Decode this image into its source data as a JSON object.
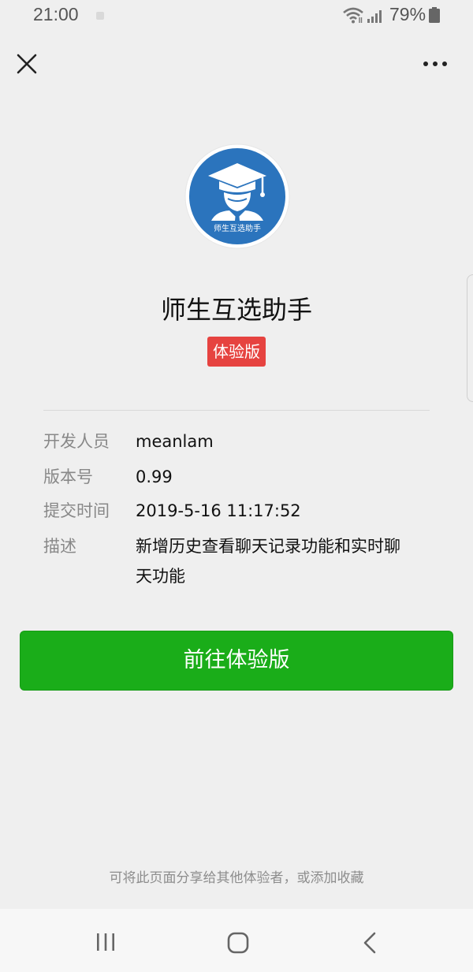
{
  "status_bar": {
    "time": "21:00",
    "battery": "79%"
  },
  "nav": {
    "close_icon": "close-icon",
    "more_icon": "more-icon"
  },
  "app": {
    "name": "师生互选助手",
    "badge": "体验版",
    "logo_text": "师生互选助手",
    "logo_colors": {
      "ring": "#ffffff",
      "circle": "#2b74bd",
      "figure": "#ffffff"
    }
  },
  "info": {
    "developer_label": "开发人员",
    "developer_value": "meanlam",
    "version_label": "版本号",
    "version_value": "0.99",
    "submit_time_label": "提交时间",
    "submit_time_value": "2019-5-16 11:17:52",
    "description_label": "描述",
    "description_value_line1": "新增历史查看聊天记录功能和实时聊",
    "description_value_line2": "天功能"
  },
  "actions": {
    "open_trial_label": "前往体验版"
  },
  "footer": {
    "share_note": "可将此页面分享给其他体验者，或添加收藏"
  },
  "colors": {
    "background": "#efefef",
    "primary": "#1aad19",
    "badge": "#e64340"
  }
}
